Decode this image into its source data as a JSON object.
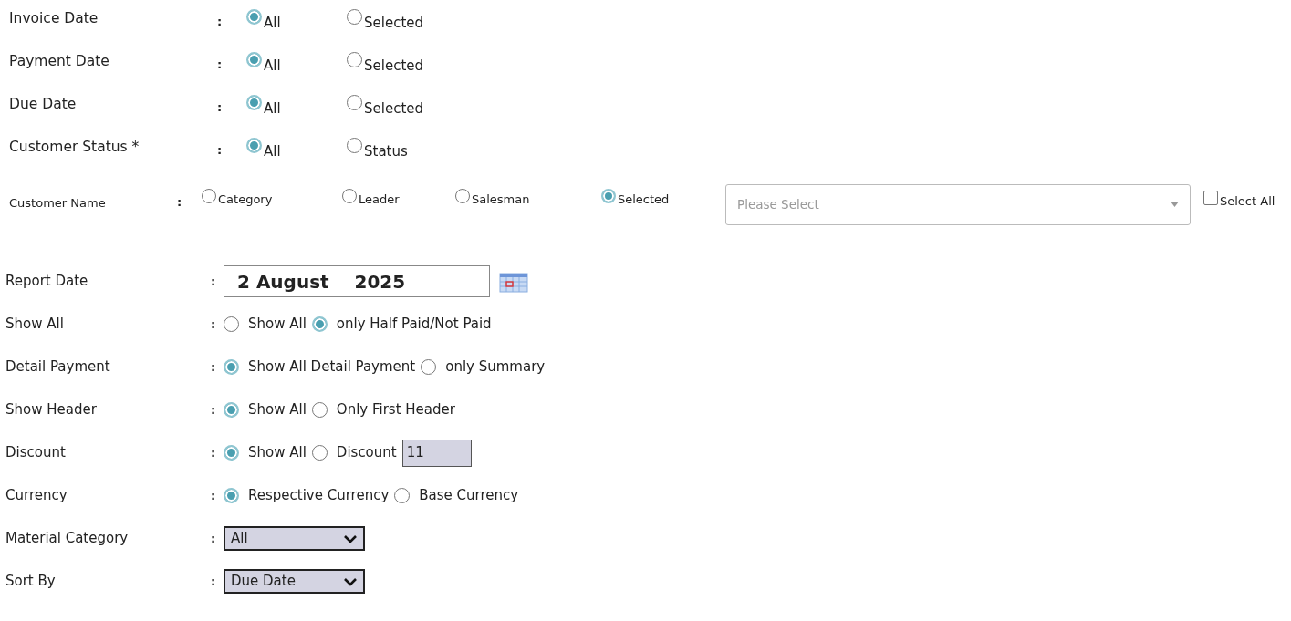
{
  "date_filters": [
    {
      "label": "Invoice Date",
      "separator": ":",
      "options": [
        {
          "label": "All",
          "selected": true
        },
        {
          "label": "Selected",
          "selected": false
        }
      ]
    },
    {
      "label": "Payment Date",
      "separator": ":",
      "options": [
        {
          "label": "All",
          "selected": true
        },
        {
          "label": "Selected",
          "selected": false
        }
      ]
    },
    {
      "label": "Due Date",
      "separator": ":",
      "options": [
        {
          "label": "All",
          "selected": true
        },
        {
          "label": "Selected",
          "selected": false
        }
      ]
    },
    {
      "label": "Customer Status *",
      "separator": ":",
      "options": [
        {
          "label": "All",
          "selected": true
        },
        {
          "label": "Status",
          "selected": false
        }
      ]
    }
  ],
  "customer_name": {
    "label": "Customer Name",
    "separator": ":",
    "options": [
      {
        "label": "Category",
        "selected": false
      },
      {
        "label": "Leader",
        "selected": false
      },
      {
        "label": "Salesman",
        "selected": false
      },
      {
        "label": "Selected",
        "selected": true
      }
    ],
    "dropdown": {
      "placeholder": "Please Select"
    },
    "select_all": {
      "label": "Select All",
      "checked": false
    }
  },
  "report_options": [
    {
      "kind": "date",
      "label": "Report Date",
      "separator": ":",
      "value": "2 August    2025"
    },
    {
      "kind": "radio",
      "label": "Show All",
      "separator": ":",
      "options": [
        {
          "label": "Show All",
          "selected": false
        },
        {
          "label": "only Half Paid/Not Paid",
          "selected": true
        }
      ]
    },
    {
      "kind": "radio",
      "label": "Detail Payment",
      "separator": ":",
      "options": [
        {
          "label": "Show All Detail Payment",
          "selected": true
        },
        {
          "label": "only Summary",
          "selected": false
        }
      ]
    },
    {
      "kind": "radio",
      "label": "Show Header",
      "separator": ":",
      "options": [
        {
          "label": "Show All",
          "selected": true
        },
        {
          "label": "Only First Header",
          "selected": false
        }
      ]
    },
    {
      "kind": "radio",
      "label": "Discount",
      "separator": ":",
      "options": [
        {
          "label": "Show All",
          "selected": true
        },
        {
          "label": "Discount",
          "selected": false
        }
      ],
      "input": {
        "value": "11"
      }
    },
    {
      "kind": "radio",
      "label": "Currency",
      "separator": ":",
      "options": [
        {
          "label": "Respective Currency",
          "selected": true
        },
        {
          "label": "Base Currency",
          "selected": false
        }
      ]
    },
    {
      "kind": "select",
      "label": "Material Category",
      "separator": ":",
      "value": "All"
    },
    {
      "kind": "select",
      "label": "Sort By",
      "separator": ":",
      "value": "Due Date"
    }
  ]
}
